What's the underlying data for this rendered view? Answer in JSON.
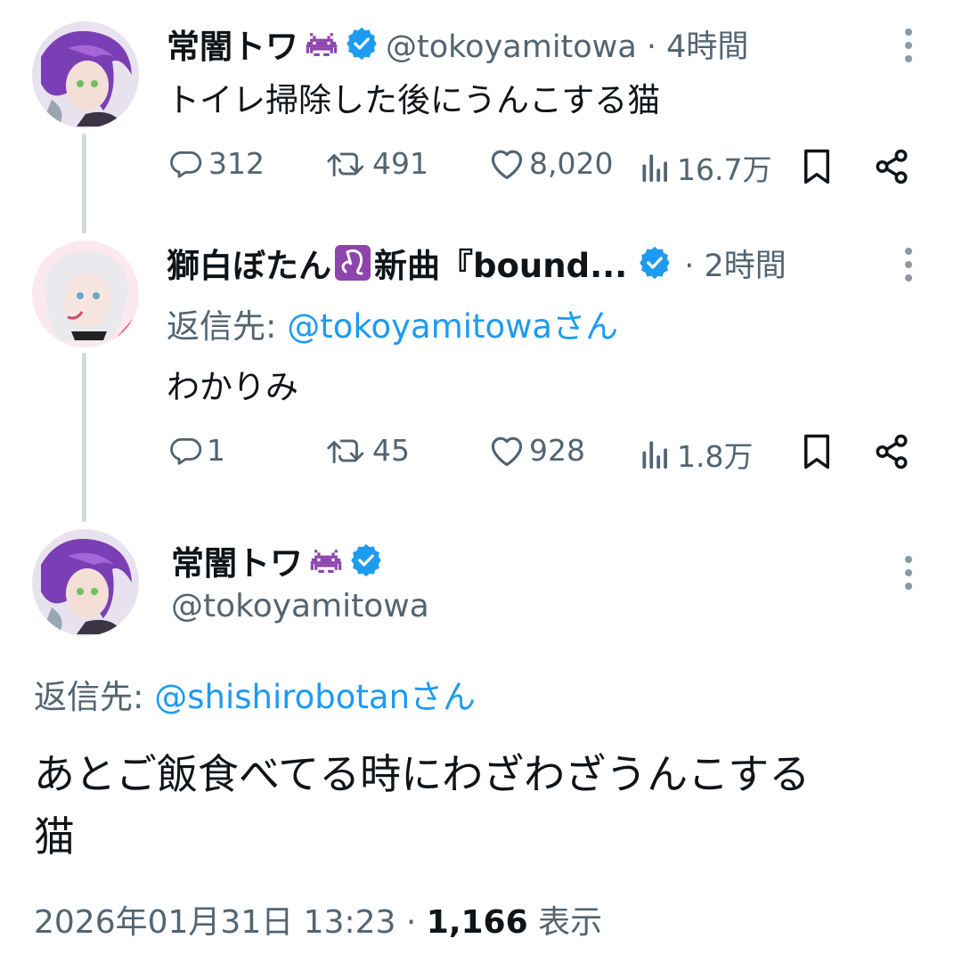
{
  "tweet1": {
    "display_name": "常闇トワ",
    "name_emoji": "alien-monster-emoji",
    "handle_time": "@tokoyamitowa · 4時間",
    "text": "トイレ掃除した後にうんこする猫",
    "stats": {
      "replies": "312",
      "retweets": "491",
      "likes": "8,020",
      "views": "16.7万"
    }
  },
  "tweet2": {
    "display_name": "獅白ぼたん",
    "name_emoji": "leo-emoji",
    "name_suffix": "新曲『bound...",
    "time": "· 2時間",
    "reply_label": "返信先:",
    "reply_handle": "@tokoyamitowaさん",
    "text": "わかりみ",
    "stats": {
      "replies": "1",
      "retweets": "45",
      "likes": "928",
      "views": "1.8万"
    }
  },
  "main_tweet": {
    "display_name": "常闇トワ",
    "handle": "@tokoyamitowa",
    "reply_label": "返信先:",
    "reply_handle": "@shishirobotanさん",
    "text_line1": "あとご飯食べてる時にわざわざうんこする",
    "text_line2": "猫",
    "timestamp": "2026年01月31日 13:23 · ",
    "view_count": "1,166",
    "view_label": "表示"
  },
  "colors": {
    "accent": "#1d9bf0",
    "gray": "#536471",
    "line": "#cfd9de",
    "verified": "#1d9bf0",
    "emoji_purple": "#8e44ad"
  }
}
